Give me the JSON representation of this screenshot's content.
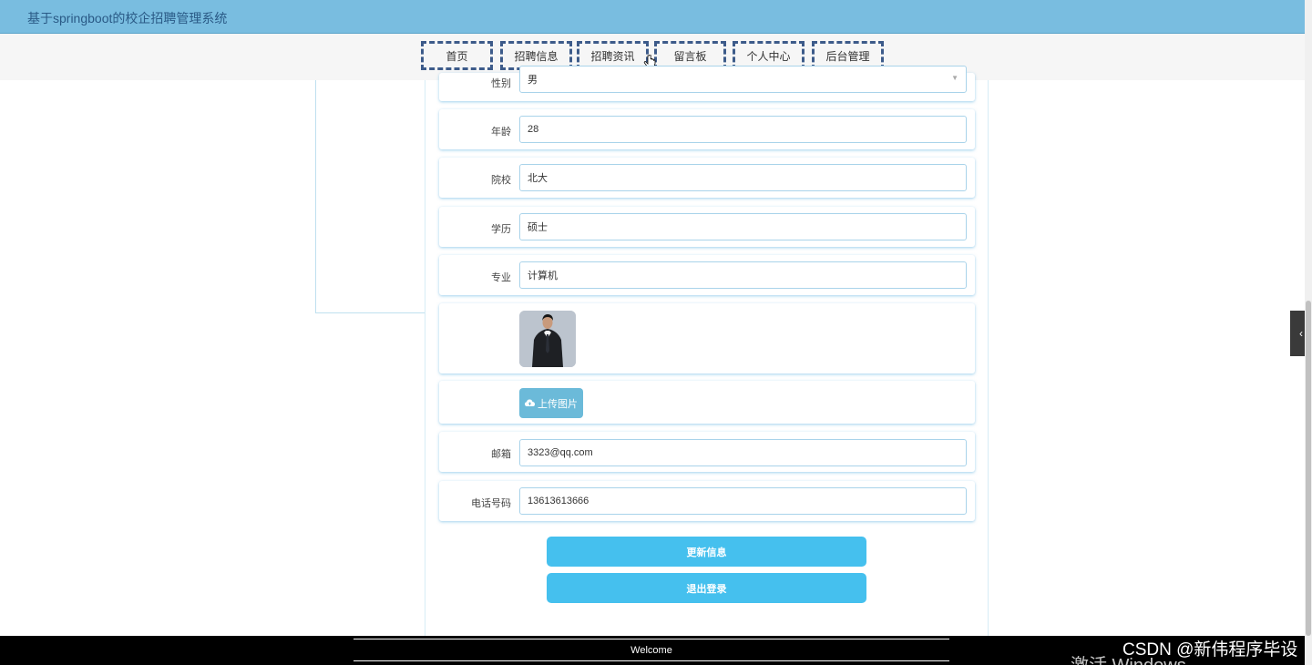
{
  "app": {
    "title": "基于springboot的校企招聘管理系统"
  },
  "nav": {
    "items": [
      {
        "label": "首页"
      },
      {
        "label": "招聘信息"
      },
      {
        "label": "招聘资讯"
      },
      {
        "label": "留言板"
      },
      {
        "label": "个人中心"
      },
      {
        "label": "后台管理"
      }
    ]
  },
  "form": {
    "gender": {
      "label": "性别",
      "value": "男"
    },
    "age": {
      "label": "年龄",
      "value": "28"
    },
    "school": {
      "label": "院校",
      "value": "北大"
    },
    "education": {
      "label": "学历",
      "value": "硕士"
    },
    "major": {
      "label": "专业",
      "value": "计算机"
    },
    "upload_label": "上传图片",
    "email": {
      "label": "邮箱",
      "value": "3323@qq.com"
    },
    "phone": {
      "label": "电话号码",
      "value": "13613613666"
    },
    "update_button": "更新信息",
    "logout_button": "退出登录"
  },
  "footer": {
    "text": "Welcome"
  },
  "watermarks": {
    "csdn": "CSDN @新伟程序毕设",
    "windows": "激活 Windows"
  },
  "colors": {
    "titlebar": "#79bde0",
    "nav_border": "#3d5b8a",
    "button": "#45c0ee",
    "upload": "#6bbad9"
  }
}
